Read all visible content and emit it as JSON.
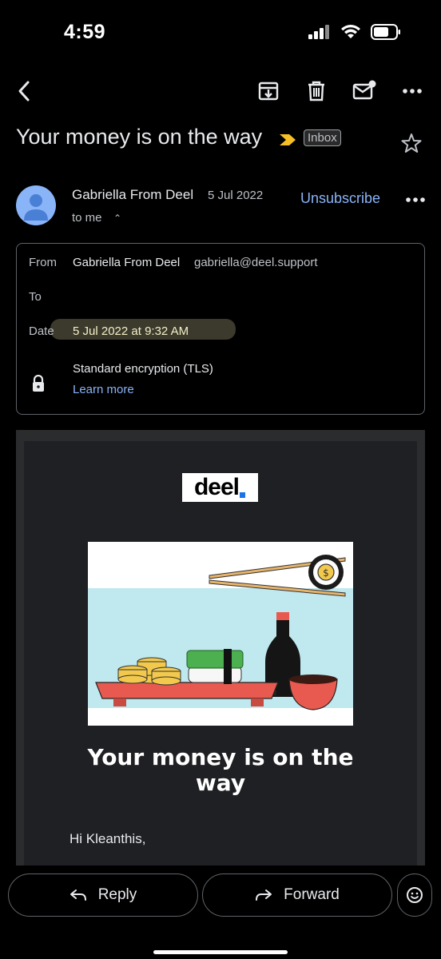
{
  "status_bar": {
    "time": "4:59"
  },
  "toolbar": {
    "back_icon": "back-arrow-icon",
    "archive_icon": "archive-icon",
    "delete_icon": "trash-icon",
    "mark_unread_icon": "mark-unread-icon",
    "more_icon": "more-vert-icon"
  },
  "email": {
    "subject": "Your money is on the way",
    "label": "Inbox",
    "sender_name": "Gabriella From Deel",
    "date_short": "5 Jul 2022",
    "to_line": "to me",
    "unsubscribe": "Unsubscribe"
  },
  "details": {
    "from_label": "From",
    "from_name": "Gabriella From Deel",
    "from_email": "gabriella@deel.support",
    "to_label": "To",
    "date_label": "Date",
    "date_value": "5 Jul 2022 at 9:32 AM",
    "encryption": "Standard encryption (TLS)",
    "learn_more": "Learn more"
  },
  "body": {
    "logo": "deel",
    "headline_line1": "Your money is on the",
    "headline_line2": "way",
    "greeting": "Hi Kleanthis,"
  },
  "actions": {
    "reply": "Reply",
    "forward": "Forward"
  },
  "colors": {
    "background": "#000000",
    "accent_link": "#8ab4f8",
    "importance": "#f6bf26",
    "logo_dot": "#1a73e8"
  }
}
